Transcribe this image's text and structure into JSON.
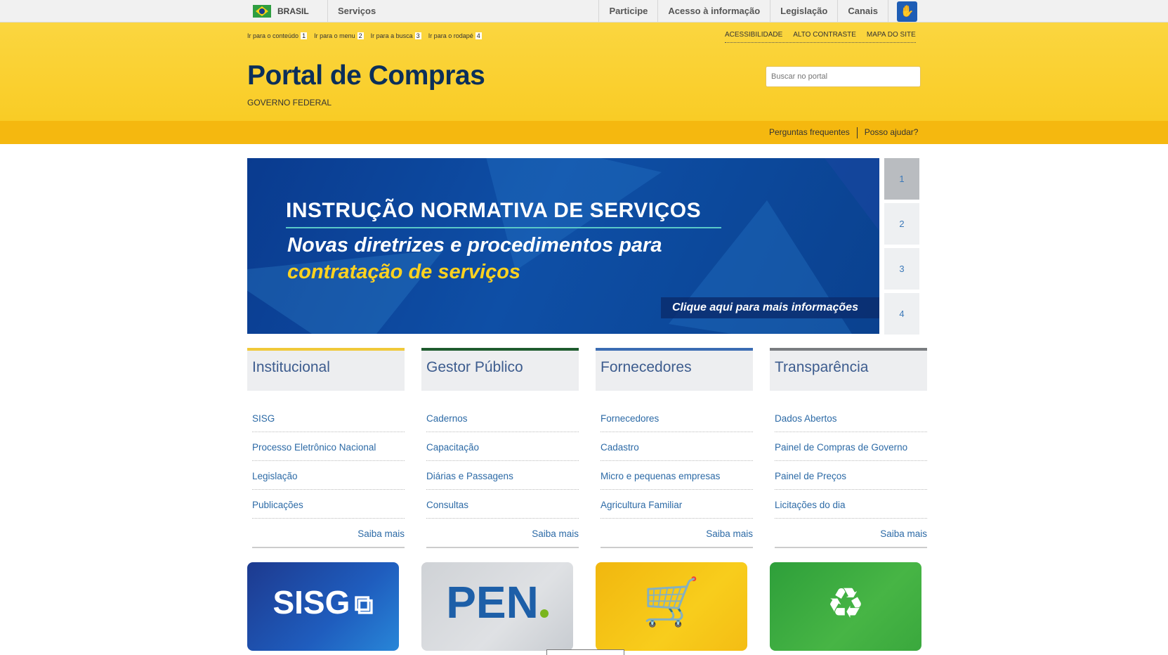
{
  "gov_bar": {
    "country": "BRASIL",
    "servicos": "Serviços",
    "nav": [
      "Participe",
      "Acesso à informação",
      "Legislação",
      "Canais"
    ]
  },
  "header": {
    "skip_links": [
      {
        "label": "Ir para o conteúdo",
        "key": "1"
      },
      {
        "label": "Ir para o menu",
        "key": "2"
      },
      {
        "label": "Ir para a busca",
        "key": "3"
      },
      {
        "label": "Ir para o rodapé",
        "key": "4"
      }
    ],
    "accessibility": [
      "ACESSIBILIDADE",
      "ALTO CONTRASTE",
      "MAPA DO SITE"
    ],
    "title": "Portal de Compras",
    "subtitle": "GOVERNO FEDERAL",
    "search_placeholder": "Buscar no portal",
    "sub_links": [
      "Perguntas frequentes",
      "Posso ajudar?"
    ]
  },
  "banner": {
    "line1": "INSTRUÇÃO NORMATIVA DE SERVIÇOS",
    "line2": "Novas diretrizes e procedimentos para",
    "line3": "contratação de serviços",
    "cta": "Clique aqui para mais informações",
    "pager": [
      "1",
      "2",
      "3",
      "4"
    ],
    "active_page": "1"
  },
  "columns": [
    {
      "title": "Institucional",
      "color": "#f0c93a",
      "links": [
        "SISG",
        "Processo Eletrônico Nacional",
        "Legislação",
        "Publicações"
      ],
      "more": "Saiba mais"
    },
    {
      "title": "Gestor Público",
      "color": "#1e5b2e",
      "links": [
        "Cadernos",
        "Capacitação",
        "Diárias e Passagens",
        "Consultas"
      ],
      "more": "Saiba mais"
    },
    {
      "title": "Fornecedores",
      "color": "#3b6cb3",
      "links": [
        "Fornecedores",
        "Cadastro",
        "Micro e pequenas empresas",
        "Agricultura Familiar"
      ],
      "more": "Saiba mais"
    },
    {
      "title": "Transparência",
      "color": "#7a7d80",
      "links": [
        "Dados Abertos",
        "Painel de Compras de Governo",
        "Painel de Preços",
        "Licitações do dia"
      ],
      "more": "Saiba mais"
    }
  ],
  "tiles": [
    {
      "label": "SISG",
      "icon": "sisg-logo-icon"
    },
    {
      "label": "PEN",
      "icon": "pen-logo-icon"
    },
    {
      "label": "",
      "icon": "shopping-cart-icon"
    },
    {
      "label": "",
      "icon": "sustainability-icon"
    }
  ]
}
